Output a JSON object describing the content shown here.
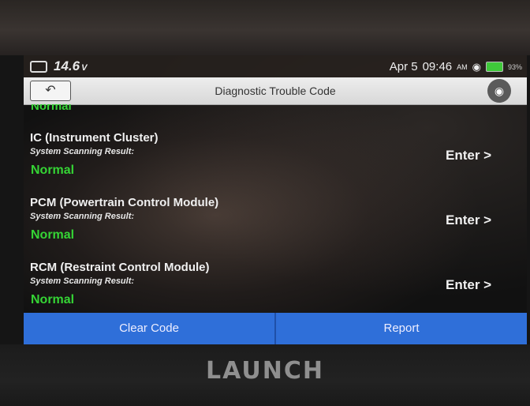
{
  "status_bar": {
    "voltage": "14.6",
    "voltage_unit": "V",
    "date": "Apr 5",
    "time": "09:46",
    "ampm": "AM",
    "battery_pct": "93%"
  },
  "header": {
    "back_icon": "back-arrow-icon",
    "title": "Diagnostic Trouble Code",
    "camera_icon": "camera-icon"
  },
  "previous_status": "Normal",
  "systems": [
    {
      "name": "IC (Instrument Cluster)",
      "sub": "System Scanning Result:",
      "status": "Normal",
      "enter": "Enter >"
    },
    {
      "name": "PCM (Powertrain Control Module)",
      "sub": "System Scanning Result:",
      "status": "Normal",
      "enter": "Enter >"
    },
    {
      "name": "RCM (Restraint Control Module)",
      "sub": "System Scanning Result:",
      "status": "Normal",
      "enter": "Enter >"
    }
  ],
  "actions": {
    "clear_code": "Clear Code",
    "report": "Report"
  },
  "brand": "LAUNCH",
  "colors": {
    "status_ok": "#35d435",
    "action_blue": "#2f6fd9"
  }
}
